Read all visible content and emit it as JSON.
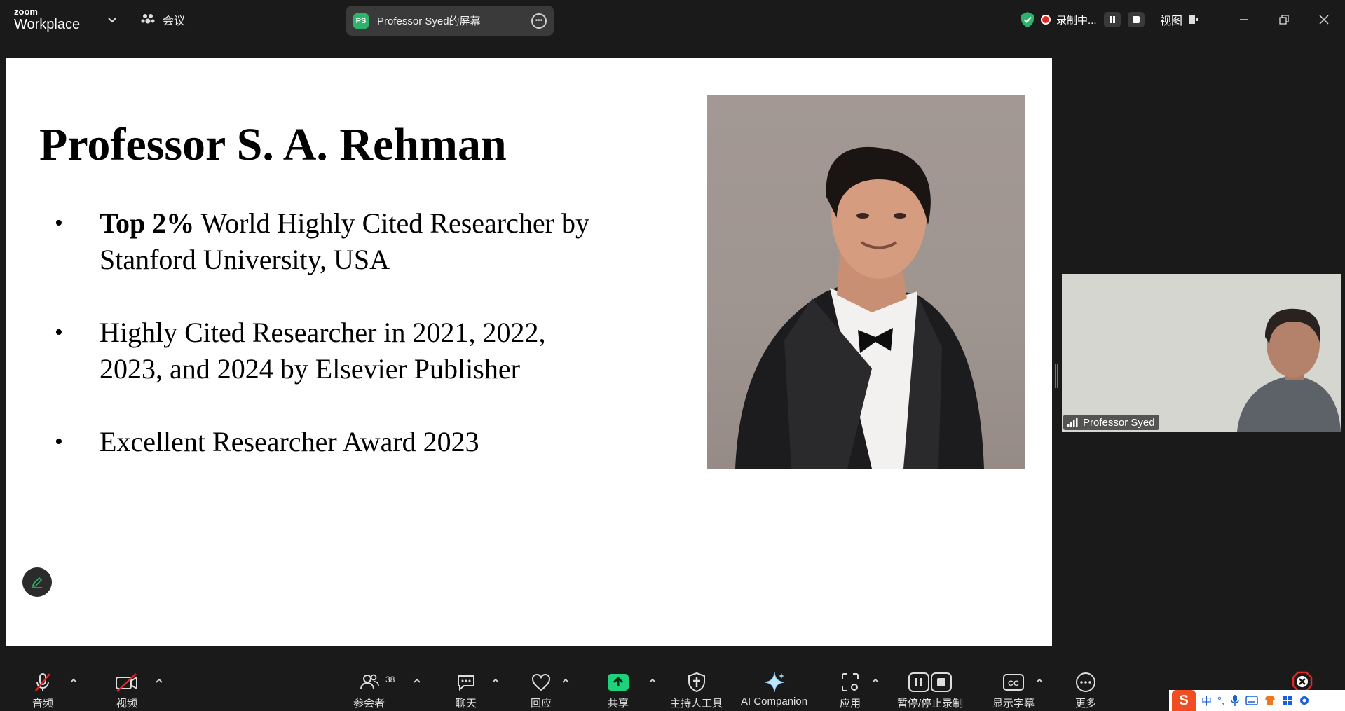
{
  "app": {
    "brand_small": "zoom",
    "brand_large": "Workplace"
  },
  "topbar": {
    "meeting_menu": "会议",
    "share_badge": "PS",
    "share_title": "Professor Syed的屏幕",
    "recording_label": "录制中...",
    "view_label": "视图"
  },
  "slide": {
    "title": "Professor S. A. Rehman",
    "bullet1_bold": "Top 2%",
    "bullet1_rest": " World Highly Cited Researcher by Stanford University, USA",
    "bullet2": "Highly Cited Researcher in 2021, 2022, 2023, and 2024 by Elsevier Publisher",
    "bullet3": "Excellent Researcher Award 2023"
  },
  "participant": {
    "name": "Professor Syed"
  },
  "toolbar": {
    "audio": "音频",
    "video": "视频",
    "participants": "参会者",
    "participants_count": "38",
    "chat": "聊天",
    "react": "回应",
    "share": "共享",
    "host_tools": "主持人工具",
    "ai_companion": "AI Companion",
    "apps": "应用",
    "pause_stop_rec": "暂停/停止录制",
    "captions": "显示字幕",
    "more": "更多"
  },
  "ime": {
    "logo": "S",
    "lang": "中",
    "punct": "°,"
  },
  "colors": {
    "accent_green": "#2db36b",
    "record_red": "#e02828",
    "share_green": "#1ed17a",
    "background": "#1a1a1a"
  }
}
